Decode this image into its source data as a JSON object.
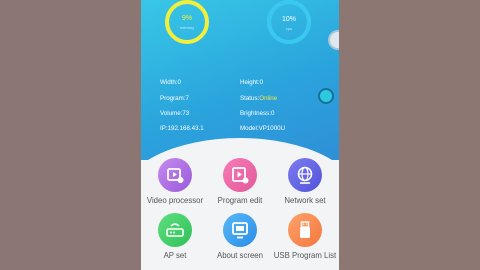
{
  "gauges": [
    {
      "value": "9%",
      "sub": "memory",
      "color": "#f2ef3c",
      "level": 0.09
    },
    {
      "value": "10%",
      "sub": "cpu",
      "color": "#39c8f0",
      "level": 0.1
    }
  ],
  "info": {
    "width": "Width:0",
    "height": "Height:0",
    "program": "Program:7",
    "status_label": "Status:",
    "status_value": "Online",
    "volume": "Volume:73",
    "brightness": "Brightness:0",
    "ip": "IP:192.168.43.1",
    "model": "Model:VP1000U"
  },
  "apps": [
    {
      "label": "Video processor",
      "icon": "video-processor-icon",
      "color": "#9a5ad8"
    },
    {
      "label": "Program edit",
      "icon": "program-edit-icon",
      "color": "#e35a9a"
    },
    {
      "label": "Network set",
      "icon": "network-icon",
      "color": "#4f53d6"
    },
    {
      "label": "AP set",
      "icon": "router-icon",
      "color": "#2fbf57"
    },
    {
      "label": "About screen",
      "icon": "screen-icon",
      "color": "#2a8de6"
    },
    {
      "label": "USB Program List",
      "icon": "usb-icon",
      "color": "#f3783f"
    }
  ]
}
